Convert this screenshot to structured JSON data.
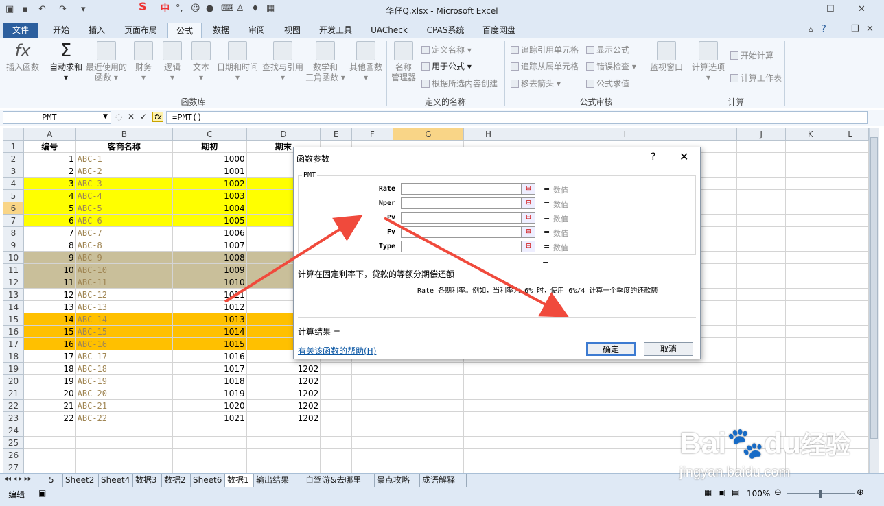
{
  "window": {
    "title": "华仔Q.xlsx - Microsoft Excel"
  },
  "tabs": [
    "文件",
    "开始",
    "插入",
    "页面布局",
    "公式",
    "数据",
    "审阅",
    "视图",
    "开发工具",
    "UACheck",
    "CPAS系统",
    "百度网盘"
  ],
  "ribbon": {
    "buttons": [
      {
        "label1": "插入函数",
        "label2": ""
      },
      {
        "label1": "自动求和",
        "label2": "▾"
      },
      {
        "label1": "最近使用的",
        "label2": "函数 ▾"
      },
      {
        "label1": "财务",
        "label2": "▾"
      },
      {
        "label1": "逻辑",
        "label2": "▾"
      },
      {
        "label1": "文本",
        "label2": "▾"
      },
      {
        "label1": "日期和时间",
        "label2": "▾"
      },
      {
        "label1": "查找与引用",
        "label2": "▾"
      },
      {
        "label1": "数学和",
        "label2": "三角函数 ▾"
      },
      {
        "label1": "其他函数",
        "label2": "▾"
      },
      {
        "label1": "名称",
        "label2": "管理器"
      }
    ],
    "names_group": [
      "定义名称 ▾",
      "用于公式 ▾",
      "根据所选内容创建"
    ],
    "audit_group": [
      "追踪引用单元格",
      "追踪从属单元格",
      "移去箭头 ▾",
      "显示公式",
      "错误检查 ▾",
      "公式求值"
    ],
    "watch": "监视窗口",
    "calc_options": {
      "label1": "计算选项",
      "label2": "▾"
    },
    "calc_items": [
      "开始计算",
      "计算工作表"
    ],
    "groups": [
      "函数库",
      "定义的名称",
      "公式审核",
      "计算"
    ]
  },
  "formula_bar": {
    "name_box": "PMT",
    "formula": "=PMT()",
    "fx": "fx"
  },
  "columns": [
    "A",
    "B",
    "C",
    "D",
    "E",
    "F",
    "G",
    "H",
    "I",
    "J",
    "K",
    "L"
  ],
  "header_row": {
    "a": "编号",
    "b": "客商名称",
    "c": "期初",
    "d": "期末"
  },
  "rows": [
    {
      "a": "1",
      "b": "ABC-1",
      "c": "1000",
      "d": "",
      "fill": ""
    },
    {
      "a": "2",
      "b": "ABC-2",
      "c": "1001",
      "d": "",
      "fill": ""
    },
    {
      "a": "3",
      "b": "ABC-3",
      "c": "1002",
      "d": "",
      "fill": "yellow"
    },
    {
      "a": "4",
      "b": "ABC-4",
      "c": "1003",
      "d": "",
      "fill": "yellow"
    },
    {
      "a": "5",
      "b": "ABC-5",
      "c": "1004",
      "d": "",
      "fill": "yellow"
    },
    {
      "a": "6",
      "b": "ABC-6",
      "c": "1005",
      "d": "",
      "fill": "yellow"
    },
    {
      "a": "7",
      "b": "ABC-7",
      "c": "1006",
      "d": "",
      "fill": ""
    },
    {
      "a": "8",
      "b": "ABC-8",
      "c": "1007",
      "d": "",
      "fill": ""
    },
    {
      "a": "9",
      "b": "ABC-9",
      "c": "1008",
      "d": "",
      "fill": "khaki"
    },
    {
      "a": "10",
      "b": "ABC-10",
      "c": "1009",
      "d": "",
      "fill": "khaki"
    },
    {
      "a": "11",
      "b": "ABC-11",
      "c": "1010",
      "d": "",
      "fill": "khaki"
    },
    {
      "a": "12",
      "b": "ABC-12",
      "c": "1011",
      "d": "",
      "fill": ""
    },
    {
      "a": "13",
      "b": "ABC-13",
      "c": "1012",
      "d": "",
      "fill": ""
    },
    {
      "a": "14",
      "b": "ABC-14",
      "c": "1013",
      "d": "",
      "fill": "orange"
    },
    {
      "a": "15",
      "b": "ABC-15",
      "c": "1014",
      "d": "",
      "fill": "orange"
    },
    {
      "a": "16",
      "b": "ABC-16",
      "c": "1015",
      "d": "",
      "fill": "orange"
    },
    {
      "a": "17",
      "b": "ABC-17",
      "c": "1016",
      "d": "",
      "fill": ""
    },
    {
      "a": "18",
      "b": "ABC-18",
      "c": "1017",
      "d": "1202",
      "fill": ""
    },
    {
      "a": "19",
      "b": "ABC-19",
      "c": "1018",
      "d": "1202",
      "fill": ""
    },
    {
      "a": "20",
      "b": "ABC-20",
      "c": "1019",
      "d": "1202",
      "fill": ""
    },
    {
      "a": "21",
      "b": "ABC-21",
      "c": "1020",
      "d": "1202",
      "fill": ""
    },
    {
      "a": "22",
      "b": "ABC-22",
      "c": "1021",
      "d": "1202",
      "fill": ""
    }
  ],
  "row_numbers": [
    "1",
    "2",
    "3",
    "4",
    "5",
    "6",
    "7",
    "8",
    "9",
    "10",
    "11",
    "12",
    "13",
    "14",
    "15",
    "16",
    "17",
    "18",
    "19",
    "20",
    "21",
    "22",
    "23",
    "24",
    "25",
    "26",
    "27"
  ],
  "sheet_tabs": [
    "5",
    "Sheet2",
    "Sheet4",
    "数据3",
    "数据2",
    "Sheet6",
    "数据1",
    "输出结果",
    "自驾游&去哪里",
    "景点攻略",
    "成语解释"
  ],
  "active_sheet": "数据1",
  "status": {
    "mode": "编辑",
    "zoom": "100%"
  },
  "dialog": {
    "title": "函数参数",
    "help_q": "?",
    "close": "✕",
    "function": "PMT",
    "args": [
      {
        "name": "Rate",
        "value": "数值"
      },
      {
        "name": "Nper",
        "value": "数值"
      },
      {
        "name": "Pv",
        "value": "数值"
      },
      {
        "name": "Fv",
        "value": "数值"
      },
      {
        "name": "Type",
        "value": "数值"
      }
    ],
    "eq": "=",
    "description": "计算在固定利率下，贷款的等额分期偿还额",
    "rate_hint": "Rate  各期利率。例如，当利率为 6% 时，使用 6%/4 计算一个季度的还款额",
    "result": "计算结果 =",
    "help_link": "有关该函数的帮助(H)",
    "ok": "确定",
    "cancel": "取消"
  },
  "watermark": {
    "brand": "Bai",
    "brand2": "du",
    "brand3": "经验",
    "url": "jingyan.baidu.com"
  }
}
